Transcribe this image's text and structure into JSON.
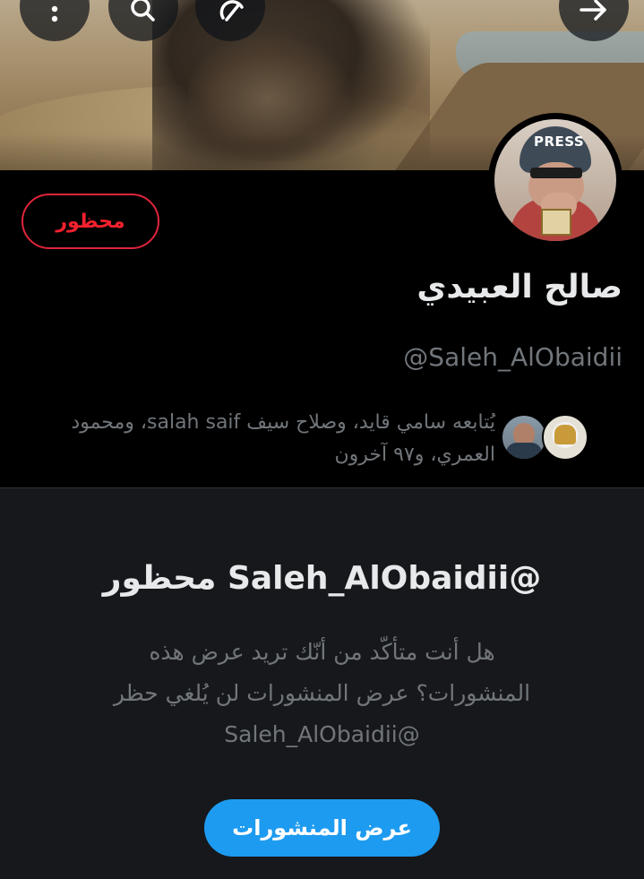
{
  "banner": {
    "buttons": {
      "more_icon": "more-vertical-icon",
      "search_icon": "search-icon",
      "share_icon": "share-icon",
      "back_icon": "arrow-right-icon"
    }
  },
  "profile": {
    "avatar_badge_text": "PRESS",
    "banned_label": "محظور",
    "display_name": "صالح العبيدي",
    "handle": "@Saleh_AlObaidii",
    "followed_by_line1": "يُتابعه سامي قايد، وصلاح سيف salah saif، ومحمود",
    "followed_by_line2": "العمري، و٩٧ آخرون"
  },
  "blocked_notice": {
    "title": "@Saleh_AlObaidii محظور",
    "desc_line1": "هل أنت متأكّد من أنّك تريد عرض هذه",
    "desc_line2": "المنشورات؟ عرض المنشورات لن يُلغي حظر",
    "desc_line3": "@Saleh_AlObaidii",
    "show_button": "عرض المنشورات"
  },
  "colors": {
    "background": "#000000",
    "panel": "#16181c",
    "accent_blue": "#1d9bf0",
    "danger_red": "#f4212e",
    "text_primary": "#e7e9ea",
    "text_secondary": "#71767b"
  }
}
